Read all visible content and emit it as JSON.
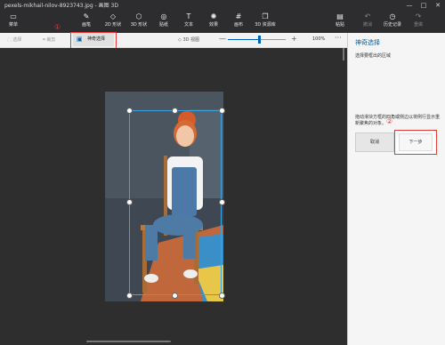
{
  "titlebar": {
    "title": "pexels-mikhail-nilov-8923743.jpg - 画图 3D",
    "min": "—",
    "max": "□",
    "close": "✕"
  },
  "ribbon": {
    "items": [
      {
        "label": "菜单",
        "icon": "folder-icon",
        "glyph": "▭"
      },
      {
        "label": "画笔",
        "icon": "brush-icon",
        "glyph": "✎"
      },
      {
        "label": "2D 形状",
        "icon": "shapes-2d-icon",
        "glyph": "◇"
      },
      {
        "label": "3D 形状",
        "icon": "shapes-3d-icon",
        "glyph": "⬡"
      },
      {
        "label": "贴纸",
        "icon": "sticker-icon",
        "glyph": "◎"
      },
      {
        "label": "文本",
        "icon": "text-icon",
        "glyph": "T"
      },
      {
        "label": "效果",
        "icon": "effects-icon",
        "glyph": "✺"
      },
      {
        "label": "画布",
        "icon": "canvas-icon",
        "glyph": "#"
      },
      {
        "label": "3D 资源库",
        "icon": "library-icon",
        "glyph": "❒"
      },
      {
        "label": "粘贴",
        "icon": "paste-icon",
        "glyph": "▤"
      },
      {
        "label": "撤消",
        "icon": "undo-icon",
        "glyph": "↶"
      },
      {
        "label": "历史记录",
        "icon": "history-icon",
        "glyph": "◷"
      },
      {
        "label": "重做",
        "icon": "redo-icon",
        "glyph": "↷"
      }
    ]
  },
  "canvasbar": {
    "select": "选择",
    "crop": "裁剪",
    "magic_select": "神奇选择",
    "view3d": "3D 视图",
    "zoom_minus": "—",
    "zoom_plus": "+",
    "zoom": "100%",
    "more": "···",
    "zoom_level": 0.55
  },
  "annotations": {
    "one": "①",
    "two": "②"
  },
  "panel": {
    "title": "神奇选择",
    "subtitle": "选择要框出的区域",
    "hint": "拖动滑块方框的四角或侧边以将例行显示重新聚焦的对象。",
    "cancel": "取消",
    "next": "下一步"
  }
}
